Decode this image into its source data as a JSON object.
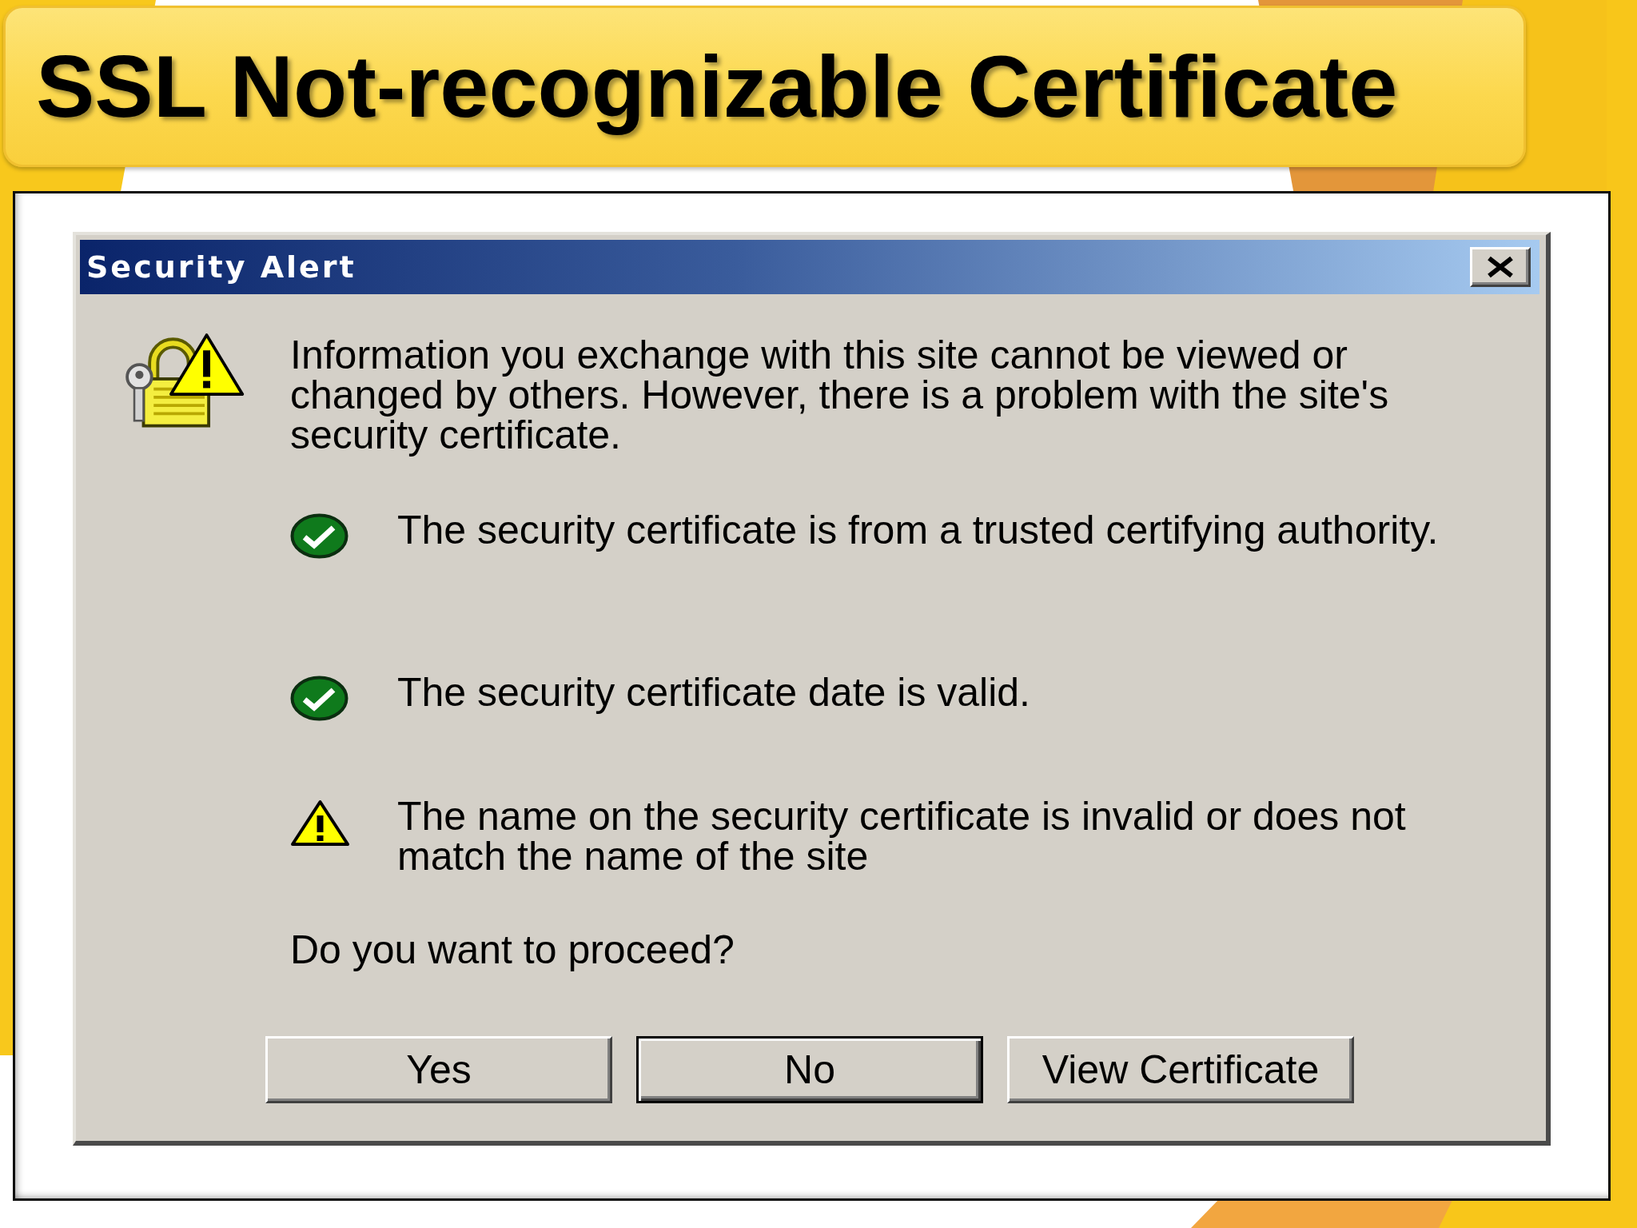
{
  "slide": {
    "title": "SSL Not-recognizable Certificate"
  },
  "dialog": {
    "title": "Security Alert",
    "message": "Information you exchange with this site cannot be viewed or changed by others. However, there is a problem with the site's security certificate.",
    "checks": [
      {
        "kind": "passed",
        "text": "The security certificate is from a trusted certifying authority."
      },
      {
        "kind": "passed",
        "text": "The security certificate date is valid."
      },
      {
        "kind": "warning",
        "text": "The name on the security certificate is invalid or does not match the name of the site"
      }
    ],
    "question": "Do you want to proceed?",
    "buttons": [
      {
        "label": "Yes",
        "default": false
      },
      {
        "label": "No",
        "default": true
      },
      {
        "label": "View Certificate",
        "default": false
      }
    ]
  }
}
